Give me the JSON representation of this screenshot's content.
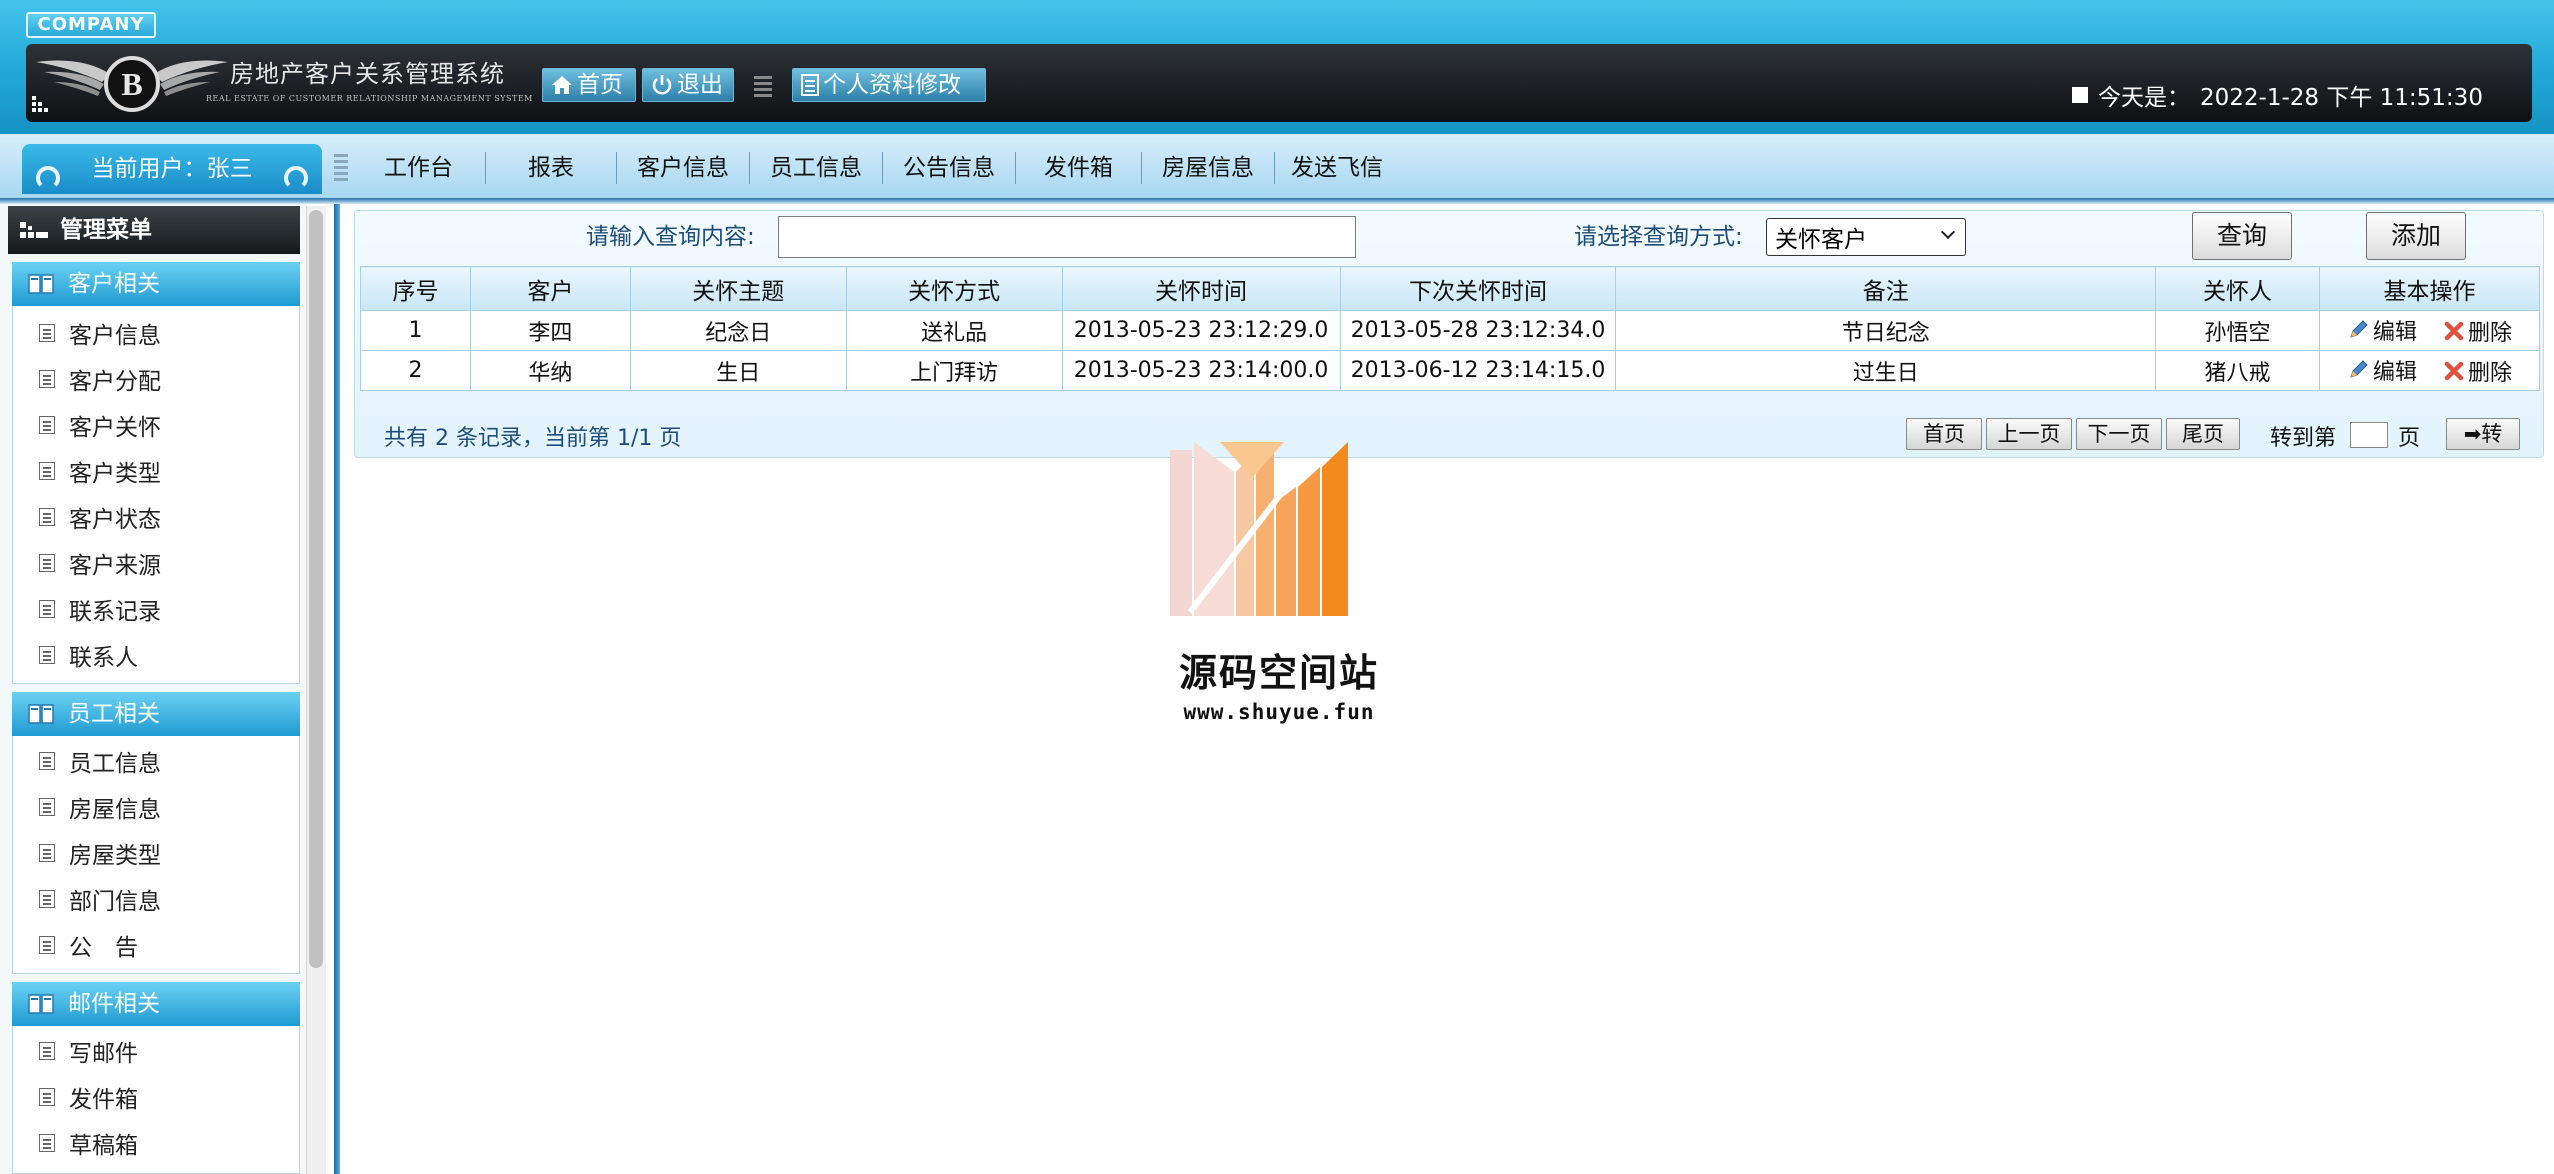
{
  "header": {
    "company": "COMPANY",
    "system_title": "房地产客户关系管理系统",
    "system_subtitle": "REAL ESTATE OF CUSTOMER RELATIONSHIP MANAGEMENT SYSTEM",
    "home_label": "首页",
    "logout_label": "退出",
    "profile_label": "个人资料修改",
    "today_label": "今天是：",
    "today_value": "2022-1-28 下午 11:51:30"
  },
  "nav": {
    "current_user": "当前用户：张三",
    "items": [
      "工作台",
      "报表",
      "客户信息",
      "员工信息",
      "公告信息",
      "发件箱",
      "房屋信息",
      "发送飞信"
    ]
  },
  "sidebar": {
    "title": "管理菜单",
    "groups": [
      {
        "title": "客户相关",
        "items": [
          "客户信息",
          "客户分配",
          "客户关怀",
          "客户类型",
          "客户状态",
          "客户来源",
          "联系记录",
          "联系人"
        ]
      },
      {
        "title": "员工相关",
        "items": [
          "员工信息",
          "房屋信息",
          "房屋类型",
          "部门信息",
          "公　告"
        ]
      },
      {
        "title": "邮件相关",
        "items": [
          "写邮件",
          "发件箱",
          "草稿箱"
        ]
      }
    ]
  },
  "search": {
    "query_label": "请输入查询内容:",
    "query_value": "",
    "mode_label": "请选择查询方式:",
    "mode_selected": "关怀客户",
    "query_button": "查询",
    "add_button": "添加"
  },
  "table": {
    "headers": [
      "序号",
      "客户",
      "关怀主题",
      "关怀方式",
      "关怀时间",
      "下次关怀时间",
      "备注",
      "关怀人",
      "基本操作"
    ],
    "rows": [
      [
        "1",
        "李四",
        "纪念日",
        "送礼品",
        "2013-05-23 23:12:29.0",
        "2013-05-28 23:12:34.0",
        "节日纪念",
        "孙悟空"
      ],
      [
        "2",
        "华纳",
        "生日",
        "上门拜访",
        "2013-05-23 23:14:00.0",
        "2013-06-12 23:14:15.0",
        "过生日",
        "猪八戒"
      ]
    ],
    "edit_label": "编辑",
    "delete_label": "删除"
  },
  "pager": {
    "info": "共有 2 条记录，当前第 1/1 页",
    "first": "首页",
    "prev": "上一页",
    "next": "下一页",
    "last": "尾页",
    "goto_label": "转到第",
    "page_unit": "页",
    "go": "➡转"
  },
  "watermark": {
    "title": "源码空间站",
    "url": "www.shuyue.fun"
  },
  "colors": {
    "header_blue": "#21a8d8",
    "dark_bar": "#15191c",
    "accent_orange": "#f28a1e"
  }
}
